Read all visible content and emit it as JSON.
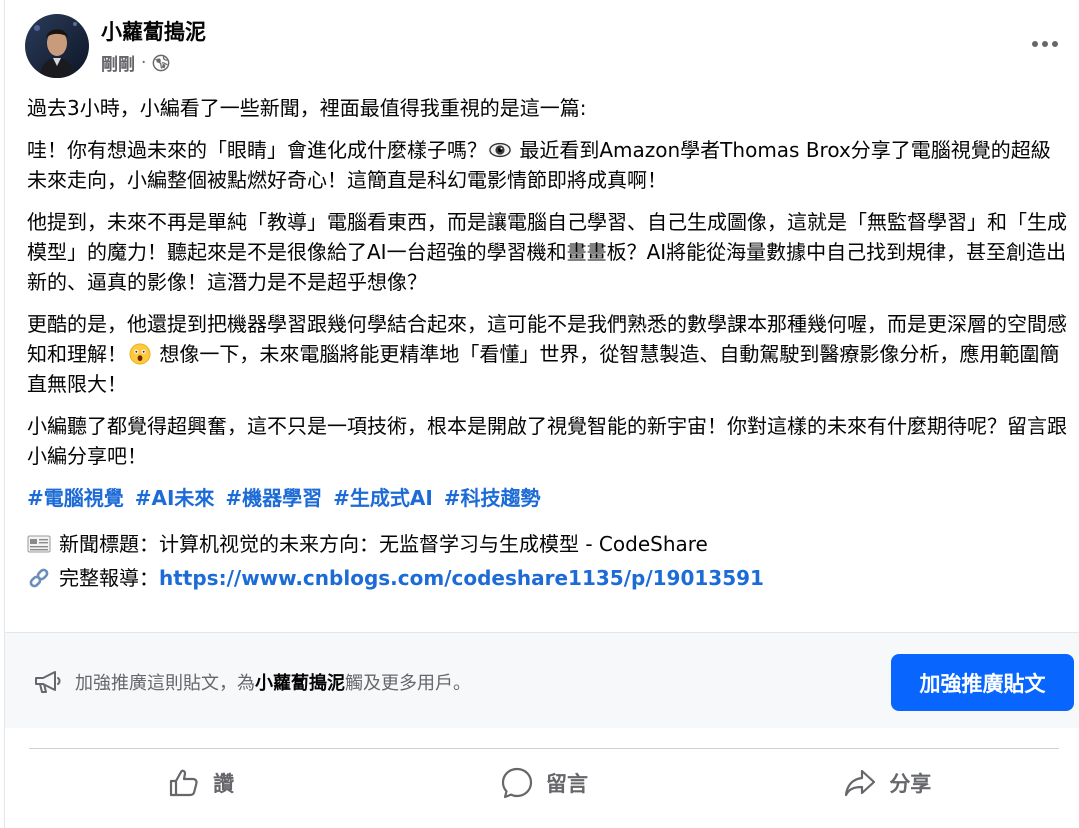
{
  "post": {
    "author": "小蘿蔔搗泥",
    "time": "剛剛",
    "separator": "·",
    "privacy_icon": "globe-icon",
    "more_icon": "more-dots-icon",
    "intro": "過去3小時，小編看了一些新聞，裡面最值得我重視的是這一篇:",
    "para1_a": "哇！你有想過未來的「眼睛」會進化成什麼樣子嗎？",
    "para1_b": " 最近看到Amazon學者Thomas Brox分享了電腦視覺的超級未來走向，小編整個被點燃好奇心！這簡直是科幻電影情節即將成真啊！",
    "para2": "他提到，未來不再是單純「教導」電腦看東西，而是讓電腦自己學習、自己生成圖像，這就是「無監督學習」和「生成模型」的魔力！聽起來是不是很像給了AI一台超強的學習機和畫畫板？AI將能從海量數據中自己找到規律，甚至創造出新的、逼真的影像！這潛力是不是超乎想像？",
    "para3_a": "更酷的是，他還提到把機器學習跟幾何學結合起來，這可能不是我們熟悉的數學課本那種幾何喔，而是更深層的空間感知和理解！",
    "para3_b": " 想像一下，未來電腦將能更精準地「看懂」世界，從智慧製造、自動駕駛到醫療影像分析，應用範圍簡直無限大！",
    "para4": "小編聽了都覺得超興奮，這不只是一項技術，根本是開啟了視覺智能的新宇宙！你對這樣的未來有什麼期待呢？留言跟小編分享吧！",
    "hashtags": [
      "#電腦視覺",
      "#AI未來",
      "#機器學習",
      "#生成式AI",
      "#科技趨勢"
    ],
    "news_title_label": "新聞標題：",
    "news_title": "计算机视觉的未来方向：无监督学习与生成模型 - CodeShare",
    "report_label": "完整報導：",
    "report_url": "https://www.cnblogs.com/codeshare1135/p/19013591"
  },
  "boost": {
    "text_prefix": "加強推廣這則貼文，為",
    "text_name": "小蘿蔔搗泥",
    "text_suffix": "觸及更多用戶。",
    "button_label": "加強推廣貼文"
  },
  "actions": {
    "like": "讚",
    "comment": "留言",
    "share": "分享"
  },
  "colors": {
    "link": "#1c6bd6",
    "boost_button": "#0866ff",
    "muted": "#65676b"
  }
}
